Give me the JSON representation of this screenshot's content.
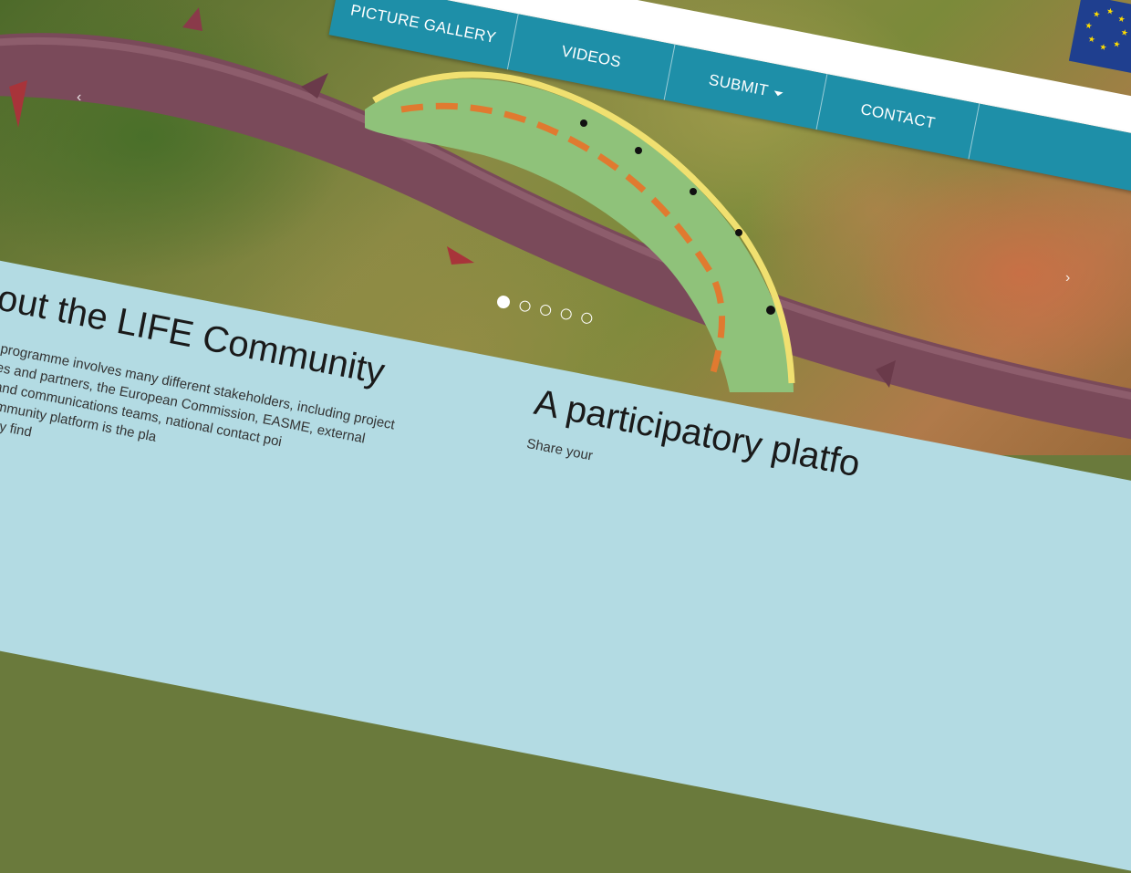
{
  "nav": {
    "items": [
      {
        "label": "PICTURE GALLERY",
        "has_caret": false
      },
      {
        "label": "VIDEOS",
        "has_caret": false
      },
      {
        "label": "SUBMIT",
        "has_caret": true
      },
      {
        "label": "CONTACT",
        "has_caret": false
      }
    ],
    "color": "#1e8fa8"
  },
  "carousel": {
    "prev_icon": "chevron-left-icon",
    "next_icon": "chevron-right-icon",
    "slide_count": 5,
    "active_slide": 1
  },
  "about": {
    "title": "bout the LIFE Community",
    "lines": [
      "LIFE programme involves many different stakeholders, including project",
      "ficiaries and partners, the European Commission, EASME, external",
      "oring and communications teams, national contact poi",
      "FE Community platform is the pla",
      "n quickly find"
    ]
  },
  "participatory": {
    "title": "A participatory platfo",
    "text": "Share your"
  },
  "colors": {
    "panel": "#b3dbe3",
    "eu_flag": "#1f3f8f",
    "eu_star": "#ffdd00"
  }
}
